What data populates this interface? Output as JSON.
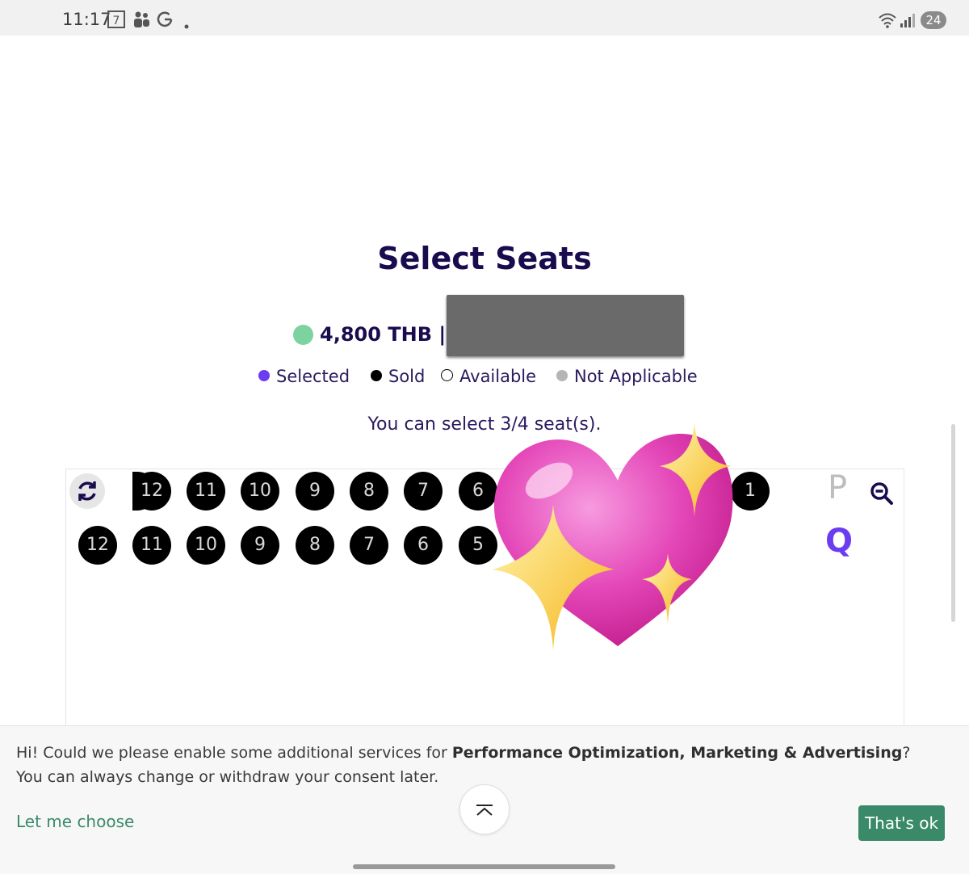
{
  "status_bar": {
    "time": "11:17",
    "icons": [
      "7-eleven-icon",
      "teams-icon",
      "google-icon",
      "dot-icon"
    ],
    "right_icons": [
      "wifi-icon",
      "signal-icon"
    ],
    "battery": "24"
  },
  "page": {
    "title": "Select Seats",
    "price": "4,800 THB |",
    "price_dot_color": "#7dd3a0",
    "legend": [
      {
        "label": "Selected",
        "color": "#6c3cf0"
      },
      {
        "label": "Sold",
        "color": "#000000"
      },
      {
        "label": "Available",
        "color": "#ffffff"
      },
      {
        "label": "Not Applicable",
        "color": "#b5b5b5"
      }
    ],
    "hint": "You can select 3/4 seat(s)."
  },
  "seat_map": {
    "row_p": {
      "label": "P",
      "label_color": "#bdbdbd",
      "seats": [
        "12",
        "11",
        "10",
        "9",
        "8",
        "7",
        "6",
        "1"
      ]
    },
    "row_q": {
      "label": "Q",
      "label_color": "#6c3cf0",
      "seats": [
        "12",
        "11",
        "10",
        "9",
        "8",
        "7",
        "6",
        "5"
      ]
    }
  },
  "consent": {
    "text_before": "Hi! Could we please enable some additional services for ",
    "text_bold": "Performance Optimization, Marketing & Advertising",
    "text_after": "? You can always change or withdraw your consent later.",
    "choose_label": "Let me choose",
    "ok_label": "That's ok",
    "accent": "#3a8a6a"
  }
}
